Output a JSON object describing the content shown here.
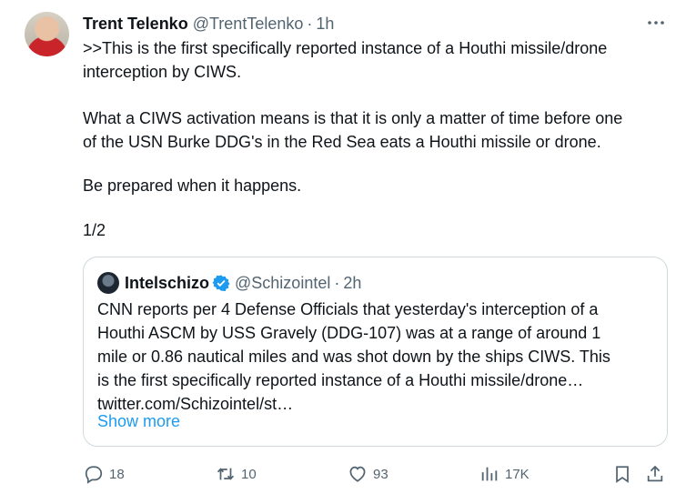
{
  "tweet": {
    "author_name": "Trent Telenko",
    "author_handle": "@TrentTelenko",
    "separator": "·",
    "time": "1h",
    "text_p1": ">>This is the first specifically reported instance of a Houthi missile/drone\ninterception by CIWS.",
    "text_p2": "What a CIWS activation means is that it is only a matter of time before one\nof the USN Burke DDG's in the Red Sea eats a Houthi missile or drone.",
    "text_p3": "Be prepared when it happens.",
    "text_p4": "1/2"
  },
  "quote": {
    "author_name": "Intelschizo",
    "author_handle": "@Schizointel",
    "separator": "·",
    "time": "2h",
    "lines": [
      "CNN reports per 4 Defense Officials that yesterday's interception of a",
      "Houthi ASCM by USS Gravely (DDG-107) was at a range of around  1",
      "mile or 0.86 nautical miles and was shot down by the ships CIWS. This",
      "is the first specifically reported instance of a Houthi missile/drone…",
      "twitter.com/Schizointel/st…"
    ],
    "show_more": "Show more"
  },
  "actions": {
    "replies": "18",
    "retweets": "10",
    "likes": "93",
    "views": "17K"
  },
  "colors": {
    "text": "#0f1419",
    "secondary": "#536471",
    "link": "#1d9bf0",
    "verified": "#1d9bf0",
    "border": "#cfd9de"
  },
  "icons": [
    "more-icon",
    "verified-badge-icon",
    "reply-icon",
    "retweet-icon",
    "like-icon",
    "views-icon",
    "bookmark-icon",
    "share-icon"
  ]
}
